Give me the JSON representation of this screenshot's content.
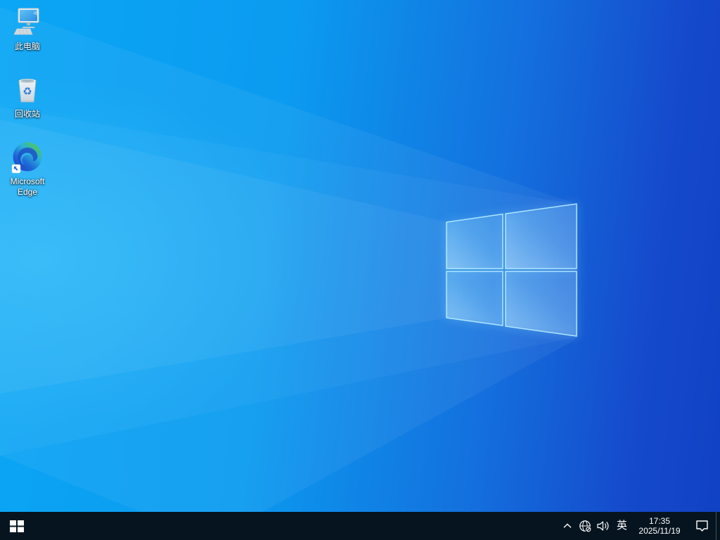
{
  "desktop": {
    "icons": [
      {
        "label": "此电脑"
      },
      {
        "label": "回收站"
      },
      {
        "label": "Microsoft Edge"
      }
    ]
  },
  "taskbar": {
    "tray": {
      "ime": "英",
      "time": "17:35",
      "date": "2025/11/19"
    },
    "tray_icon_names": [
      "hidden-icons-chevron",
      "network-no-internet-globe",
      "volume-speaker",
      "ime-indicator",
      "clock",
      "action-center",
      "show-desktop"
    ]
  },
  "glyphs": {
    "recycle": "♻"
  },
  "colors": {
    "taskbar_bg": "#05141f",
    "wallpaper_left": "#0ba6f5",
    "wallpaper_right": "#1041c4",
    "logo_pane_glow": "#b8f0ff",
    "tray_foreground": "#ffffff"
  }
}
